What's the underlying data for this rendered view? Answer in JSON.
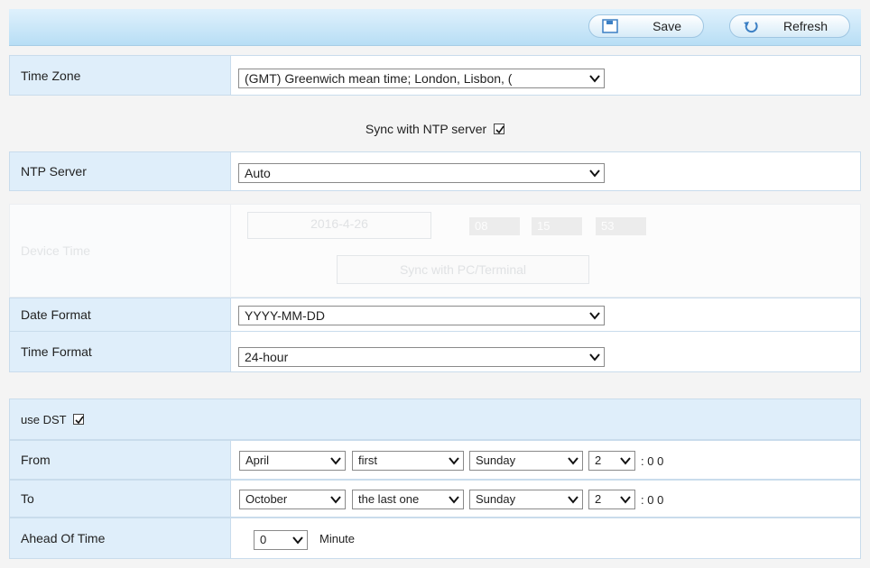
{
  "toolbar": {
    "save_label": "Save",
    "refresh_label": "Refresh"
  },
  "time_zone": {
    "label": "Time Zone",
    "value": "(GMT) Greenwich mean time; London, Lisbon, ("
  },
  "ntp_sync": {
    "label": "Sync with NTP server",
    "checked": true
  },
  "ntp_server": {
    "label": "NTP Server",
    "value": "Auto"
  },
  "device_time": {
    "label": "Device Time",
    "date": "2016-4-26",
    "hour": "08",
    "minute": "15",
    "second": "53",
    "sync_label": "Sync with PC/Terminal"
  },
  "date_format": {
    "label": "Date Format",
    "value": "YYYY-MM-DD"
  },
  "time_format": {
    "label": "Time Format",
    "value": "24-hour"
  },
  "dst": {
    "label": "use DST",
    "checked": true
  },
  "from": {
    "label": "From",
    "month": "April",
    "week": "first",
    "day": "Sunday",
    "hour": "2",
    "suffix": ": 0 0"
  },
  "to": {
    "label": "To",
    "month": "October",
    "week": "the last one",
    "day": "Sunday",
    "hour": "2",
    "suffix": ": 0 0"
  },
  "ahead": {
    "label": "Ahead Of Time",
    "value": "0",
    "unit": "Minute"
  },
  "colors": {
    "label_bg": "#dfeefa",
    "toolbar_bg": "#c4e4f8",
    "border": "#c9dcec"
  }
}
